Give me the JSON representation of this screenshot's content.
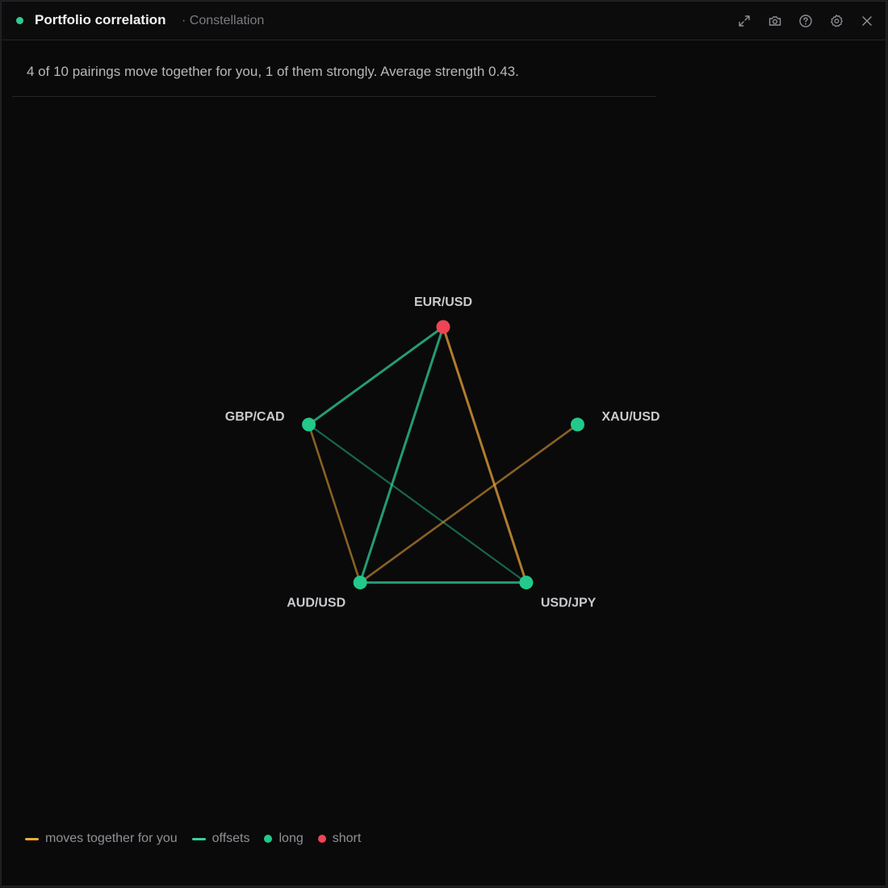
{
  "header": {
    "title": "Portfolio correlation",
    "subtitle": "· Constellation",
    "status_color": "#2ecc8f",
    "buttons": [
      {
        "name": "expand",
        "icon": "expand-icon"
      },
      {
        "name": "screenshot",
        "icon": "camera-icon"
      },
      {
        "name": "help",
        "icon": "help-icon"
      },
      {
        "name": "settings",
        "icon": "gear-icon"
      },
      {
        "name": "close",
        "icon": "close-icon"
      }
    ]
  },
  "summary": "4 of 10 pairings move together for you, 1 of them strongly. Average strength 0.43.",
  "colors": {
    "long": "#22c98a",
    "short": "#ef4456",
    "moves_together": "#f0a93a",
    "offsets": "#2fd49b"
  },
  "graph": {
    "nodes": [
      {
        "id": "EUR/USD",
        "label": "EUR/USD",
        "side": "short"
      },
      {
        "id": "XAU/USD",
        "label": "XAU/USD",
        "side": "long"
      },
      {
        "id": "USD/JPY",
        "label": "USD/JPY",
        "side": "long"
      },
      {
        "id": "AUD/USD",
        "label": "AUD/USD",
        "side": "long"
      },
      {
        "id": "GBP/CAD",
        "label": "GBP/CAD",
        "side": "long"
      }
    ],
    "edges": [
      {
        "source": "EUR/USD",
        "target": "GBP/CAD",
        "relation": "offsets",
        "strength": "strong"
      },
      {
        "source": "EUR/USD",
        "target": "AUD/USD",
        "relation": "offsets",
        "strength": "strong"
      },
      {
        "source": "EUR/USD",
        "target": "USD/JPY",
        "relation": "moves_together",
        "strength": "strong"
      },
      {
        "source": "GBP/CAD",
        "target": "AUD/USD",
        "relation": "moves_together",
        "strength": "moderate"
      },
      {
        "source": "GBP/CAD",
        "target": "USD/JPY",
        "relation": "offsets",
        "strength": "weak"
      },
      {
        "source": "AUD/USD",
        "target": "USD/JPY",
        "relation": "offsets",
        "strength": "strong"
      },
      {
        "source": "AUD/USD",
        "target": "XAU/USD",
        "relation": "moves_together",
        "strength": "moderate"
      }
    ]
  },
  "legend": {
    "moves_together": "moves together for you",
    "offsets": "offsets",
    "long": "long",
    "short": "short"
  }
}
